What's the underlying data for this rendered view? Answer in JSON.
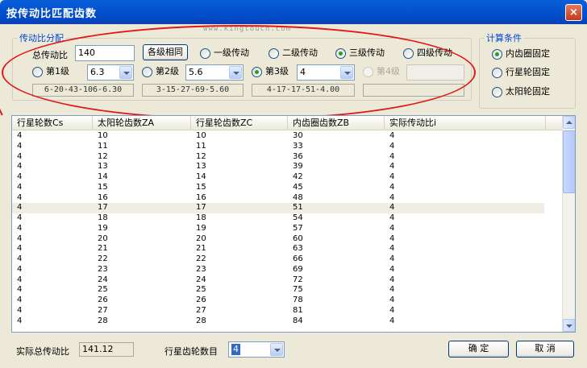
{
  "window": {
    "title": "按传动比匹配齿数",
    "close_glyph": "×"
  },
  "watermark": "www.kingtouch.com",
  "ratio_group": {
    "legend": "传动比分配",
    "total_ratio_label": "总传动比",
    "total_ratio_value": "140",
    "same_levels_button": "各级相同",
    "stage_options": [
      {
        "label": "一级传动",
        "selected": false
      },
      {
        "label": "二级传动",
        "selected": false
      },
      {
        "label": "三级传动",
        "selected": true
      },
      {
        "label": "四级传动",
        "selected": false
      }
    ],
    "stages": [
      {
        "label": "第1级",
        "value": "6.3",
        "selected": false,
        "enabled": true,
        "readout": "6-20-43-106-6.30"
      },
      {
        "label": "第2级",
        "value": "5.6",
        "selected": false,
        "enabled": true,
        "readout": "3-15-27-69-5.60"
      },
      {
        "label": "第3级",
        "value": "4",
        "selected": true,
        "enabled": true,
        "readout": "4-17-17-51-4.00"
      },
      {
        "label": "第4级",
        "value": "",
        "selected": false,
        "enabled": false,
        "readout": ""
      }
    ]
  },
  "calc_group": {
    "legend": "计算条件",
    "options": [
      {
        "label": "内齿圈固定",
        "selected": true
      },
      {
        "label": "行星轮固定",
        "selected": false
      },
      {
        "label": "太阳轮固定",
        "selected": false
      }
    ]
  },
  "table": {
    "columns": [
      "行星轮数Cs",
      "太阳轮齿数ZA",
      "行星轮齿数ZC",
      "内齿圈齿数ZB",
      "实际传动比i"
    ],
    "highlight_row": 7,
    "rows": [
      [
        "4",
        "10",
        "10",
        "30",
        "4"
      ],
      [
        "4",
        "11",
        "11",
        "33",
        "4"
      ],
      [
        "4",
        "12",
        "12",
        "36",
        "4"
      ],
      [
        "4",
        "13",
        "13",
        "39",
        "4"
      ],
      [
        "4",
        "14",
        "14",
        "42",
        "4"
      ],
      [
        "4",
        "15",
        "15",
        "45",
        "4"
      ],
      [
        "4",
        "16",
        "16",
        "48",
        "4"
      ],
      [
        "4",
        "17",
        "17",
        "51",
        "4"
      ],
      [
        "4",
        "18",
        "18",
        "54",
        "4"
      ],
      [
        "4",
        "19",
        "19",
        "57",
        "4"
      ],
      [
        "4",
        "20",
        "20",
        "60",
        "4"
      ],
      [
        "4",
        "21",
        "21",
        "63",
        "4"
      ],
      [
        "4",
        "22",
        "22",
        "66",
        "4"
      ],
      [
        "4",
        "23",
        "23",
        "69",
        "4"
      ],
      [
        "4",
        "24",
        "24",
        "72",
        "4"
      ],
      [
        "4",
        "25",
        "25",
        "75",
        "4"
      ],
      [
        "4",
        "26",
        "26",
        "78",
        "4"
      ],
      [
        "4",
        "27",
        "27",
        "81",
        "4"
      ],
      [
        "4",
        "28",
        "28",
        "84",
        "4"
      ]
    ]
  },
  "footer": {
    "actual_total_label": "实际总传动比",
    "actual_total_value": "141.12",
    "planet_count_label": "行星齿轮数目",
    "planet_count_value": "4",
    "ok_button": "确 定",
    "cancel_button": "取 消"
  },
  "colors": {
    "annotation": "#E01818",
    "legend_text": "#0046D5",
    "title_bar": "#0453D0"
  }
}
